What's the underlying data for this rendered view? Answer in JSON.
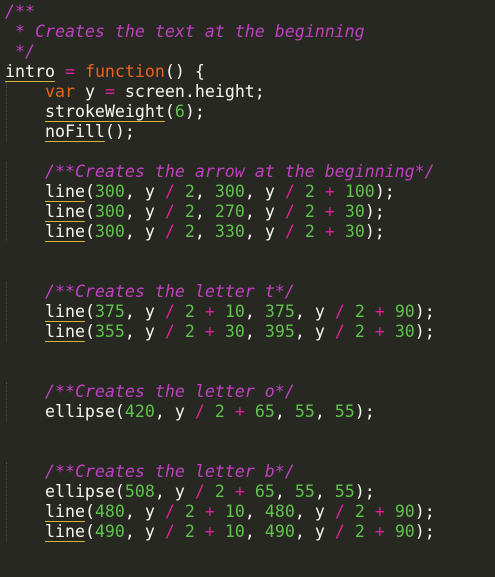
{
  "editor": {
    "lines": [
      [
        {
          "t": "/**",
          "c": "cm"
        }
      ],
      [
        {
          "t": " * Creates the text at the beginning",
          "c": "cm"
        }
      ],
      [
        {
          "t": " */",
          "c": "cm"
        }
      ],
      [
        {
          "t": "intro",
          "c": "fn"
        },
        {
          "t": " ",
          "c": "pn"
        },
        {
          "t": "=",
          "c": "op"
        },
        {
          "t": " ",
          "c": "pn"
        },
        {
          "t": "function",
          "c": "kw"
        },
        {
          "t": "() {",
          "c": "pn"
        }
      ],
      [
        {
          "t": "    ",
          "c": "pn"
        },
        {
          "t": "var",
          "c": "kw"
        },
        {
          "t": " y ",
          "c": "pn"
        },
        {
          "t": "=",
          "c": "op"
        },
        {
          "t": " screen.height;",
          "c": "pn"
        }
      ],
      [
        {
          "t": "    ",
          "c": "pn"
        },
        {
          "t": "strokeWeight",
          "c": "fn"
        },
        {
          "t": "(",
          "c": "pn"
        },
        {
          "t": "6",
          "c": "num"
        },
        {
          "t": ");",
          "c": "pn"
        }
      ],
      [
        {
          "t": "    ",
          "c": "pn"
        },
        {
          "t": "noFill",
          "c": "fn"
        },
        {
          "t": "();",
          "c": "pn"
        }
      ],
      [],
      [
        {
          "t": "    ",
          "c": "pn"
        },
        {
          "t": "/**Creates the arrow at the beginning*/",
          "c": "cm"
        }
      ],
      [
        {
          "t": "    ",
          "c": "pn"
        },
        {
          "t": "line",
          "c": "fn"
        },
        {
          "t": "(",
          "c": "pn"
        },
        {
          "t": "300",
          "c": "num"
        },
        {
          "t": ", y ",
          "c": "pn"
        },
        {
          "t": "/",
          "c": "op"
        },
        {
          "t": " ",
          "c": "pn"
        },
        {
          "t": "2",
          "c": "num"
        },
        {
          "t": ", ",
          "c": "pn"
        },
        {
          "t": "300",
          "c": "num"
        },
        {
          "t": ", y ",
          "c": "pn"
        },
        {
          "t": "/",
          "c": "op"
        },
        {
          "t": " ",
          "c": "pn"
        },
        {
          "t": "2",
          "c": "num"
        },
        {
          "t": " ",
          "c": "pn"
        },
        {
          "t": "+",
          "c": "op"
        },
        {
          "t": " ",
          "c": "pn"
        },
        {
          "t": "100",
          "c": "num"
        },
        {
          "t": ");",
          "c": "pn"
        }
      ],
      [
        {
          "t": "    ",
          "c": "pn"
        },
        {
          "t": "line",
          "c": "fn"
        },
        {
          "t": "(",
          "c": "pn"
        },
        {
          "t": "300",
          "c": "num"
        },
        {
          "t": ", y ",
          "c": "pn"
        },
        {
          "t": "/",
          "c": "op"
        },
        {
          "t": " ",
          "c": "pn"
        },
        {
          "t": "2",
          "c": "num"
        },
        {
          "t": ", ",
          "c": "pn"
        },
        {
          "t": "270",
          "c": "num"
        },
        {
          "t": ", y ",
          "c": "pn"
        },
        {
          "t": "/",
          "c": "op"
        },
        {
          "t": " ",
          "c": "pn"
        },
        {
          "t": "2",
          "c": "num"
        },
        {
          "t": " ",
          "c": "pn"
        },
        {
          "t": "+",
          "c": "op"
        },
        {
          "t": " ",
          "c": "pn"
        },
        {
          "t": "30",
          "c": "num"
        },
        {
          "t": ");",
          "c": "pn"
        }
      ],
      [
        {
          "t": "    ",
          "c": "pn"
        },
        {
          "t": "line",
          "c": "fn"
        },
        {
          "t": "(",
          "c": "pn"
        },
        {
          "t": "300",
          "c": "num"
        },
        {
          "t": ", y ",
          "c": "pn"
        },
        {
          "t": "/",
          "c": "op"
        },
        {
          "t": " ",
          "c": "pn"
        },
        {
          "t": "2",
          "c": "num"
        },
        {
          "t": ", ",
          "c": "pn"
        },
        {
          "t": "330",
          "c": "num"
        },
        {
          "t": ", y ",
          "c": "pn"
        },
        {
          "t": "/",
          "c": "op"
        },
        {
          "t": " ",
          "c": "pn"
        },
        {
          "t": "2",
          "c": "num"
        },
        {
          "t": " ",
          "c": "pn"
        },
        {
          "t": "+",
          "c": "op"
        },
        {
          "t": " ",
          "c": "pn"
        },
        {
          "t": "30",
          "c": "num"
        },
        {
          "t": ");",
          "c": "pn"
        }
      ],
      [],
      [],
      [
        {
          "t": "    ",
          "c": "pn"
        },
        {
          "t": "/**Creates the letter t*/",
          "c": "cm"
        }
      ],
      [
        {
          "t": "    ",
          "c": "pn"
        },
        {
          "t": "line",
          "c": "fn"
        },
        {
          "t": "(",
          "c": "pn"
        },
        {
          "t": "375",
          "c": "num"
        },
        {
          "t": ", y ",
          "c": "pn"
        },
        {
          "t": "/",
          "c": "op"
        },
        {
          "t": " ",
          "c": "pn"
        },
        {
          "t": "2",
          "c": "num"
        },
        {
          "t": " ",
          "c": "pn"
        },
        {
          "t": "+",
          "c": "op"
        },
        {
          "t": " ",
          "c": "pn"
        },
        {
          "t": "10",
          "c": "num"
        },
        {
          "t": ", ",
          "c": "pn"
        },
        {
          "t": "375",
          "c": "num"
        },
        {
          "t": ", y ",
          "c": "pn"
        },
        {
          "t": "/",
          "c": "op"
        },
        {
          "t": " ",
          "c": "pn"
        },
        {
          "t": "2",
          "c": "num"
        },
        {
          "t": " ",
          "c": "pn"
        },
        {
          "t": "+",
          "c": "op"
        },
        {
          "t": " ",
          "c": "pn"
        },
        {
          "t": "90",
          "c": "num"
        },
        {
          "t": ");",
          "c": "pn"
        }
      ],
      [
        {
          "t": "    ",
          "c": "pn"
        },
        {
          "t": "line",
          "c": "fn"
        },
        {
          "t": "(",
          "c": "pn"
        },
        {
          "t": "355",
          "c": "num"
        },
        {
          "t": ", y ",
          "c": "pn"
        },
        {
          "t": "/",
          "c": "op"
        },
        {
          "t": " ",
          "c": "pn"
        },
        {
          "t": "2",
          "c": "num"
        },
        {
          "t": " ",
          "c": "pn"
        },
        {
          "t": "+",
          "c": "op"
        },
        {
          "t": " ",
          "c": "pn"
        },
        {
          "t": "30",
          "c": "num"
        },
        {
          "t": ", ",
          "c": "pn"
        },
        {
          "t": "395",
          "c": "num"
        },
        {
          "t": ", y ",
          "c": "pn"
        },
        {
          "t": "/",
          "c": "op"
        },
        {
          "t": " ",
          "c": "pn"
        },
        {
          "t": "2",
          "c": "num"
        },
        {
          "t": " ",
          "c": "pn"
        },
        {
          "t": "+",
          "c": "op"
        },
        {
          "t": " ",
          "c": "pn"
        },
        {
          "t": "30",
          "c": "num"
        },
        {
          "t": ");",
          "c": "pn"
        }
      ],
      [],
      [],
      [
        {
          "t": "    ",
          "c": "pn"
        },
        {
          "t": "/**Creates the letter o*/",
          "c": "cm"
        }
      ],
      [
        {
          "t": "    ",
          "c": "pn"
        },
        {
          "t": "ellipse",
          "c": "id"
        },
        {
          "t": "(",
          "c": "pn"
        },
        {
          "t": "420",
          "c": "num"
        },
        {
          "t": ", y ",
          "c": "pn"
        },
        {
          "t": "/",
          "c": "op"
        },
        {
          "t": " ",
          "c": "pn"
        },
        {
          "t": "2",
          "c": "num"
        },
        {
          "t": " ",
          "c": "pn"
        },
        {
          "t": "+",
          "c": "op"
        },
        {
          "t": " ",
          "c": "pn"
        },
        {
          "t": "65",
          "c": "num"
        },
        {
          "t": ", ",
          "c": "pn"
        },
        {
          "t": "55",
          "c": "num"
        },
        {
          "t": ", ",
          "c": "pn"
        },
        {
          "t": "55",
          "c": "num"
        },
        {
          "t": ");",
          "c": "pn"
        }
      ],
      [],
      [],
      [
        {
          "t": "    ",
          "c": "pn"
        },
        {
          "t": "/**Creates the letter b*/",
          "c": "cm"
        }
      ],
      [
        {
          "t": "    ",
          "c": "pn"
        },
        {
          "t": "ellipse",
          "c": "id"
        },
        {
          "t": "(",
          "c": "pn"
        },
        {
          "t": "508",
          "c": "num"
        },
        {
          "t": ", y ",
          "c": "pn"
        },
        {
          "t": "/",
          "c": "op"
        },
        {
          "t": " ",
          "c": "pn"
        },
        {
          "t": "2",
          "c": "num"
        },
        {
          "t": " ",
          "c": "pn"
        },
        {
          "t": "+",
          "c": "op"
        },
        {
          "t": " ",
          "c": "pn"
        },
        {
          "t": "65",
          "c": "num"
        },
        {
          "t": ", ",
          "c": "pn"
        },
        {
          "t": "55",
          "c": "num"
        },
        {
          "t": ", ",
          "c": "pn"
        },
        {
          "t": "55",
          "c": "num"
        },
        {
          "t": ");",
          "c": "pn"
        }
      ],
      [
        {
          "t": "    ",
          "c": "pn"
        },
        {
          "t": "line",
          "c": "fn"
        },
        {
          "t": "(",
          "c": "pn"
        },
        {
          "t": "480",
          "c": "num"
        },
        {
          "t": ", y ",
          "c": "pn"
        },
        {
          "t": "/",
          "c": "op"
        },
        {
          "t": " ",
          "c": "pn"
        },
        {
          "t": "2",
          "c": "num"
        },
        {
          "t": " ",
          "c": "pn"
        },
        {
          "t": "+",
          "c": "op"
        },
        {
          "t": " ",
          "c": "pn"
        },
        {
          "t": "10",
          "c": "num"
        },
        {
          "t": ", ",
          "c": "pn"
        },
        {
          "t": "480",
          "c": "num"
        },
        {
          "t": ", y ",
          "c": "pn"
        },
        {
          "t": "/",
          "c": "op"
        },
        {
          "t": " ",
          "c": "pn"
        },
        {
          "t": "2",
          "c": "num"
        },
        {
          "t": " ",
          "c": "pn"
        },
        {
          "t": "+",
          "c": "op"
        },
        {
          "t": " ",
          "c": "pn"
        },
        {
          "t": "90",
          "c": "num"
        },
        {
          "t": ");",
          "c": "pn"
        }
      ],
      [
        {
          "t": "    ",
          "c": "pn"
        },
        {
          "t": "line",
          "c": "fn"
        },
        {
          "t": "(",
          "c": "pn"
        },
        {
          "t": "490",
          "c": "num"
        },
        {
          "t": ", y ",
          "c": "pn"
        },
        {
          "t": "/",
          "c": "op"
        },
        {
          "t": " ",
          "c": "pn"
        },
        {
          "t": "2",
          "c": "num"
        },
        {
          "t": " ",
          "c": "pn"
        },
        {
          "t": "+",
          "c": "op"
        },
        {
          "t": " ",
          "c": "pn"
        },
        {
          "t": "10",
          "c": "num"
        },
        {
          "t": ", ",
          "c": "pn"
        },
        {
          "t": "490",
          "c": "num"
        },
        {
          "t": ", y ",
          "c": "pn"
        },
        {
          "t": "/",
          "c": "op"
        },
        {
          "t": " ",
          "c": "pn"
        },
        {
          "t": "2",
          "c": "num"
        },
        {
          "t": " ",
          "c": "pn"
        },
        {
          "t": "+",
          "c": "op"
        },
        {
          "t": " ",
          "c": "pn"
        },
        {
          "t": "90",
          "c": "num"
        },
        {
          "t": ");",
          "c": "pn"
        }
      ]
    ]
  },
  "colors": {
    "background": "#272822",
    "comment": "#c040c0",
    "keyword": "#e8641e",
    "number": "#5fc24a",
    "operator": "#e0209a",
    "text": "#f8f8f2",
    "function_underline": "#d4b640"
  }
}
